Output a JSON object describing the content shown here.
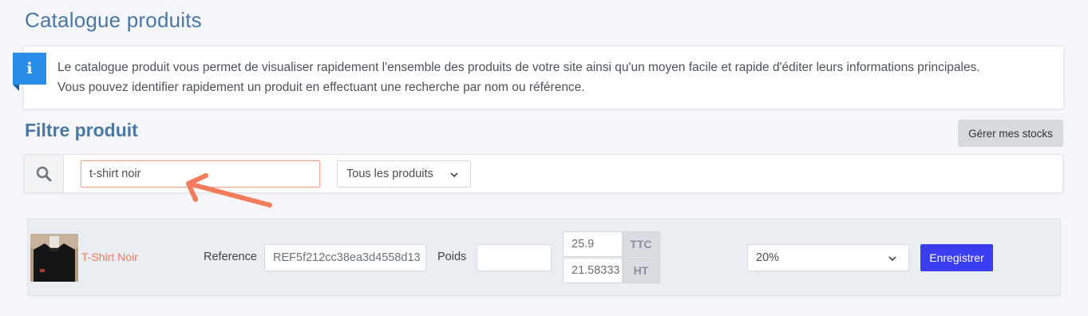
{
  "header": {
    "title": "Catalogue produits"
  },
  "info": {
    "badge": "i",
    "line1": "Le catalogue produit vous permet de visualiser rapidement l'ensemble des produits de votre site ainsi qu'un moyen facile et rapide d'éditer leurs informations principales.",
    "line2": "Vous pouvez identifier rapidement un produit en effectuant une recherche par nom ou référence."
  },
  "filter": {
    "title": "Filtre produit",
    "stocks_button": "Gérer mes stocks",
    "search_value": "t-shirt noir",
    "category_select": "Tous les produits"
  },
  "product": {
    "name": "T-Shirt Noir",
    "reference_label": "Reference",
    "reference_value": "REF5f212cc38ea3d4558d13",
    "weight_label": "Poids",
    "weight_value": "",
    "price_ttc": "25.9",
    "ttc_label": "TTC",
    "price_ht": "21.58333",
    "ht_label": "HT",
    "vat_rate": "20%",
    "save_button": "Enregistrer"
  },
  "colors": {
    "accent_blue": "#4b77a4",
    "info_blue": "#2a8de8",
    "annotation_orange": "#f47c5a",
    "product_name": "#f07c5c",
    "save_button": "#3a3df2"
  }
}
